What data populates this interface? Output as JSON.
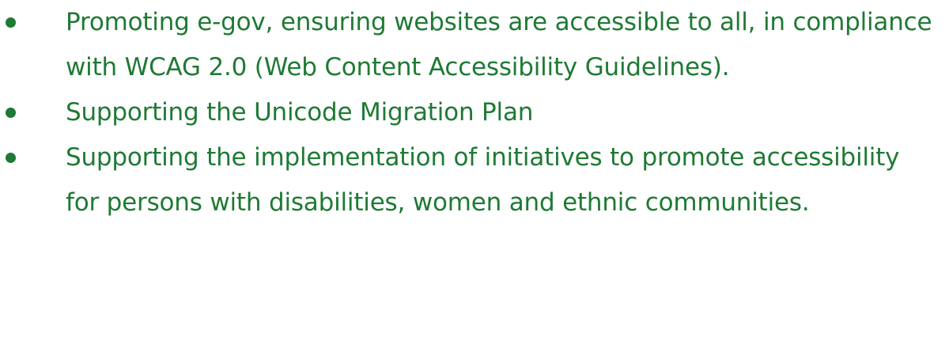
{
  "colors": {
    "text": "#1e7a34",
    "bullet": "#1e7a34",
    "background": "#ffffff"
  },
  "bullets": {
    "items": [
      {
        "text": "Promoting e-gov, ensuring websites are accessible to all, in compliance with WCAG 2.0 (Web Content Accessibility Guidelines)."
      },
      {
        "text": "Supporting the Unicode Migration Plan"
      },
      {
        "text": "Supporting the implementation of initiatives to promote accessibility for persons with disabilities, women and ethnic communities."
      }
    ]
  }
}
